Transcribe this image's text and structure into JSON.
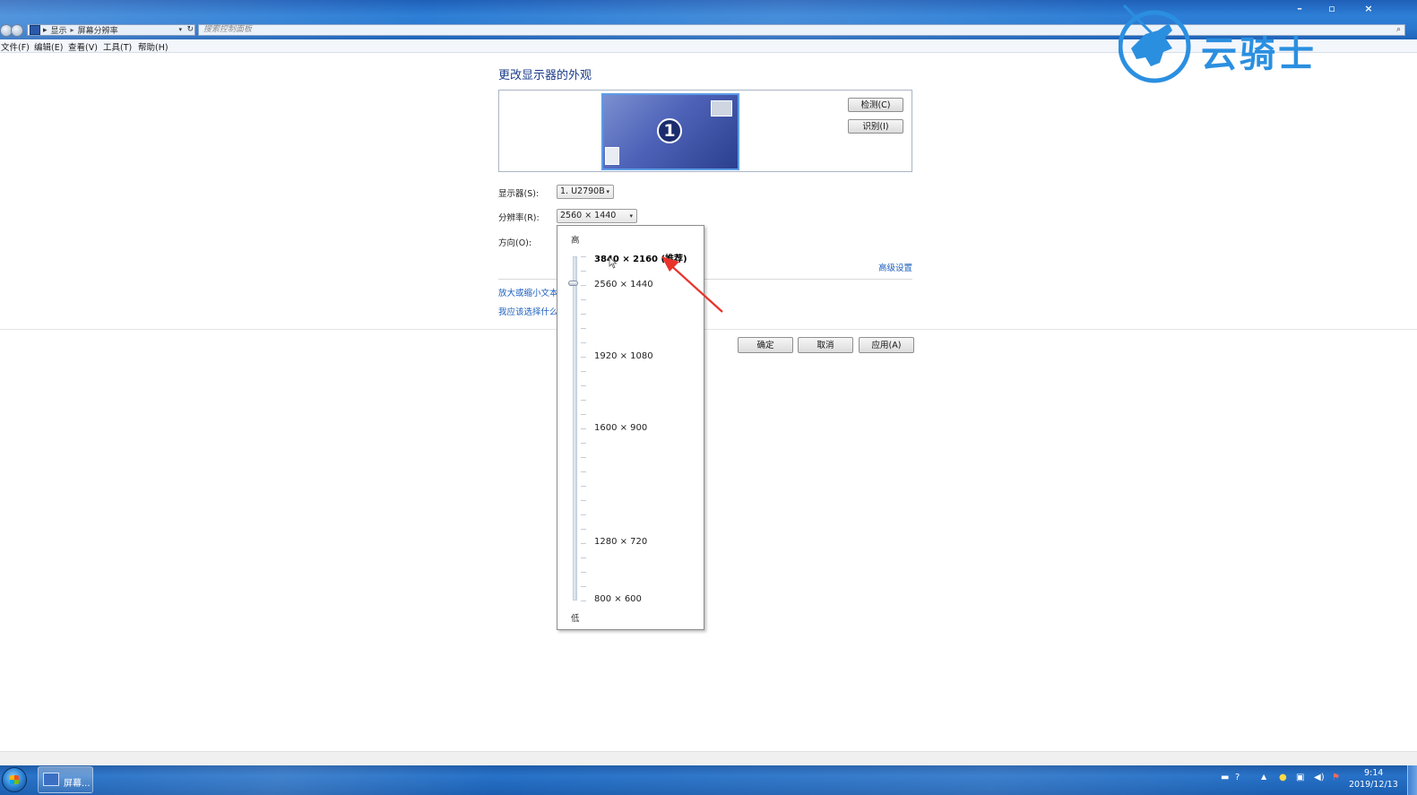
{
  "window": {
    "controls": {
      "minimize": "–",
      "maximize": "▫",
      "close": "×"
    },
    "address": {
      "crumb1": "显示",
      "crumb2": "屏幕分辨率",
      "separator": "▸"
    },
    "search": {
      "placeholder": "搜索控制面板"
    }
  },
  "menu": {
    "file": "文件(F)",
    "edit": "编辑(E)",
    "view": "查看(V)",
    "tools": "工具(T)",
    "help": "帮助(H)"
  },
  "logo": {
    "text": "云骑士"
  },
  "main": {
    "title": "更改显示器的外观",
    "monitor_number": "1",
    "detect_button": "检测(C)",
    "identify_button": "识别(I)",
    "display_label": "显示器(S):",
    "display_value": "1. U2790B",
    "resolution_label": "分辨率(R):",
    "resolution_value": "2560 × 1440",
    "orientation_label": "方向(O):",
    "advanced_link": "高级设置",
    "link_zoom": "放大或缩小文本",
    "link_choose": "我应该选择什么",
    "ok_button": "确定",
    "cancel_button": "取消",
    "apply_button": "应用(A)"
  },
  "resolution_dropdown": {
    "high_label": "高",
    "low_label": "低",
    "selected": "2560 × 1440",
    "options": [
      {
        "label": "3840 × 2160 (推荐)",
        "recommended": true
      },
      {
        "label": "2560 × 1440",
        "recommended": false
      },
      {
        "label": "1920 × 1080",
        "recommended": false
      },
      {
        "label": "1600 × 900",
        "recommended": false
      },
      {
        "label": "1280 × 720",
        "recommended": false
      },
      {
        "label": "800 × 600",
        "recommended": false
      }
    ]
  },
  "taskbar": {
    "app_label": "屏幕...",
    "time": "9:14",
    "date": "2019/12/13"
  },
  "colors": {
    "accent_blue": "#1c5fbd",
    "annotation_red": "#e8332a",
    "logo_blue": "#2b8fe0"
  }
}
